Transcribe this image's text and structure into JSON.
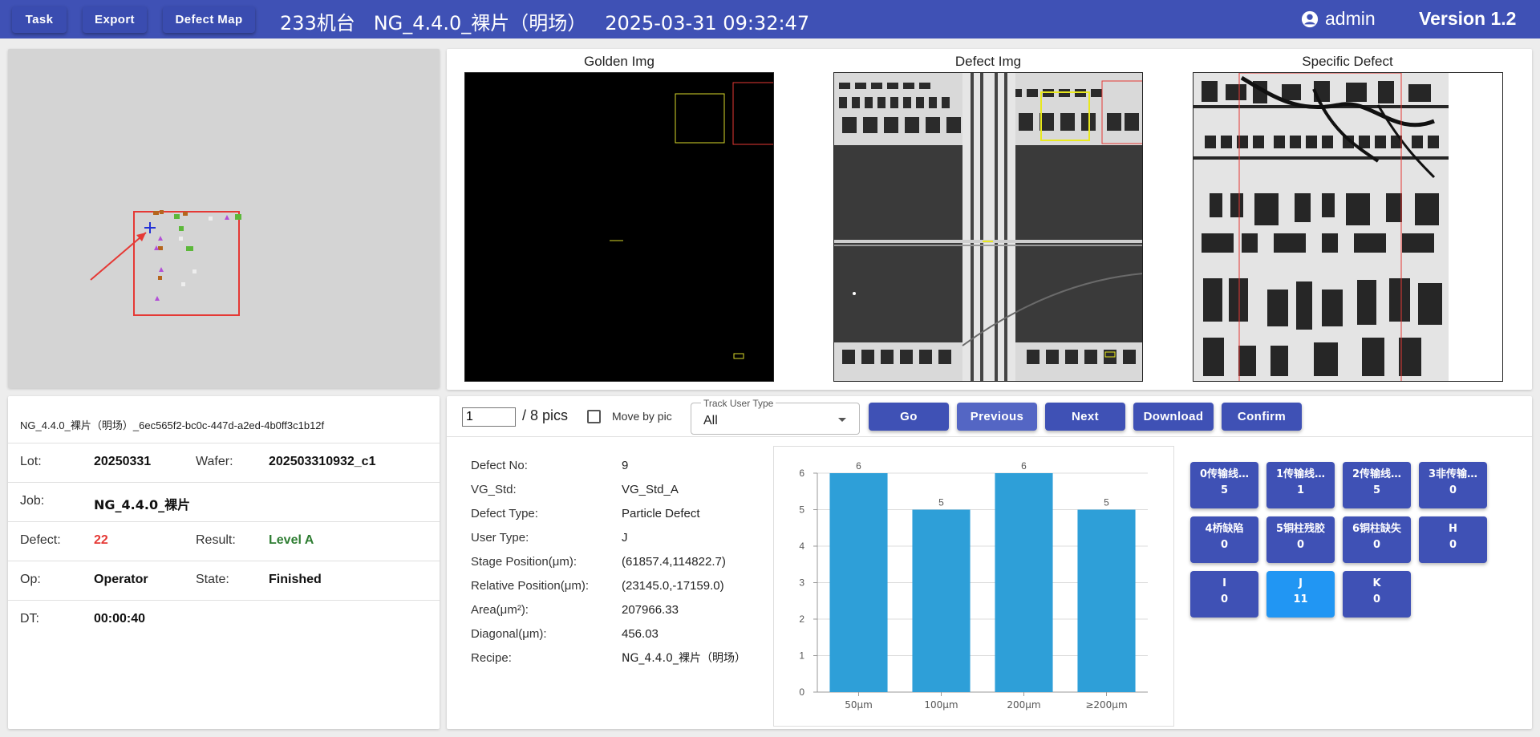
{
  "topbar": {
    "buttons": [
      "Task",
      "Export",
      "Defect Map"
    ],
    "title": "233机台   NG_4.4.0_裸片（明场）   2025-03-31 09:32:47",
    "user": "admin",
    "version": "Version 1.2"
  },
  "images": {
    "golden_title": "Golden Img",
    "defect_title": "Defect Img",
    "specific_title": "Specific Defect"
  },
  "info": {
    "filename": "NG_4.4.0_裸片（明场）_6ec565f2-bc0c-447d-a2ed-4b0ff3c1b12f",
    "lot_label": "Lot:",
    "lot": "20250331",
    "wafer_label": "Wafer:",
    "wafer": "202503310932_c1",
    "job_label": "Job:",
    "job": "NG_4.4.0_裸片",
    "defect_label": "Defect:",
    "defect": "22",
    "result_label": "Result:",
    "result": "Level A",
    "op_label": "Op:",
    "op": "Operator",
    "state_label": "State:",
    "state": "Finished",
    "dt_label": "DT:",
    "dt": "00:00:40",
    "colors": {
      "defect": "#e53935",
      "result": "#2e7d32"
    }
  },
  "nav": {
    "page_value": "1",
    "page_total": "/ 8 pics",
    "move_by_pic": "Move by pic",
    "track_label": "Track User Type",
    "track_value": "All",
    "buttons": {
      "go": "Go",
      "previous": "Previous",
      "next": "Next",
      "download": "Download",
      "confirm": "Confirm"
    }
  },
  "details": [
    {
      "label": "Defect No:",
      "value": "9"
    },
    {
      "label": "VG_Std:",
      "value": "VG_Std_A"
    },
    {
      "label": "Defect Type:",
      "value": "Particle Defect"
    },
    {
      "label": "User Type:",
      "value": "J"
    },
    {
      "label": "Stage Position(μm):",
      "value": "(61857.4,114822.7)"
    },
    {
      "label": "Relative Position(μm):",
      "value": "(23145.0,-17159.0)"
    },
    {
      "label": "Area(μm²):",
      "value": "207966.33"
    },
    {
      "label": "Diagonal(μm):",
      "value": "456.03"
    },
    {
      "label": "Recipe:",
      "value": "NG_4.4.0_裸片（明场）"
    }
  ],
  "chart_data": {
    "type": "bar",
    "categories": [
      "50μm",
      "100μm",
      "200μm",
      "≥200μm"
    ],
    "values": [
      6,
      5,
      6,
      5
    ],
    "ylim": [
      0,
      6
    ],
    "yticks": [
      "0",
      "1",
      "2",
      "3",
      "4",
      "5",
      "6"
    ],
    "color": "#2e9fd8",
    "grid": true
  },
  "categories": [
    {
      "name": "0传输线…",
      "count": "5"
    },
    {
      "name": "1传输线…",
      "count": "1"
    },
    {
      "name": "2传输线…",
      "count": "5"
    },
    {
      "name": "3非传输…",
      "count": "0"
    },
    {
      "name": "4桥缺陷",
      "count": "0"
    },
    {
      "name": "5铜柱残胶",
      "count": "0"
    },
    {
      "name": "6铜柱缺失",
      "count": "0"
    },
    {
      "name": "H",
      "count": "0"
    },
    {
      "name": "I",
      "count": "0"
    },
    {
      "name": "J",
      "count": "11",
      "active": true
    },
    {
      "name": "K",
      "count": "0"
    }
  ]
}
